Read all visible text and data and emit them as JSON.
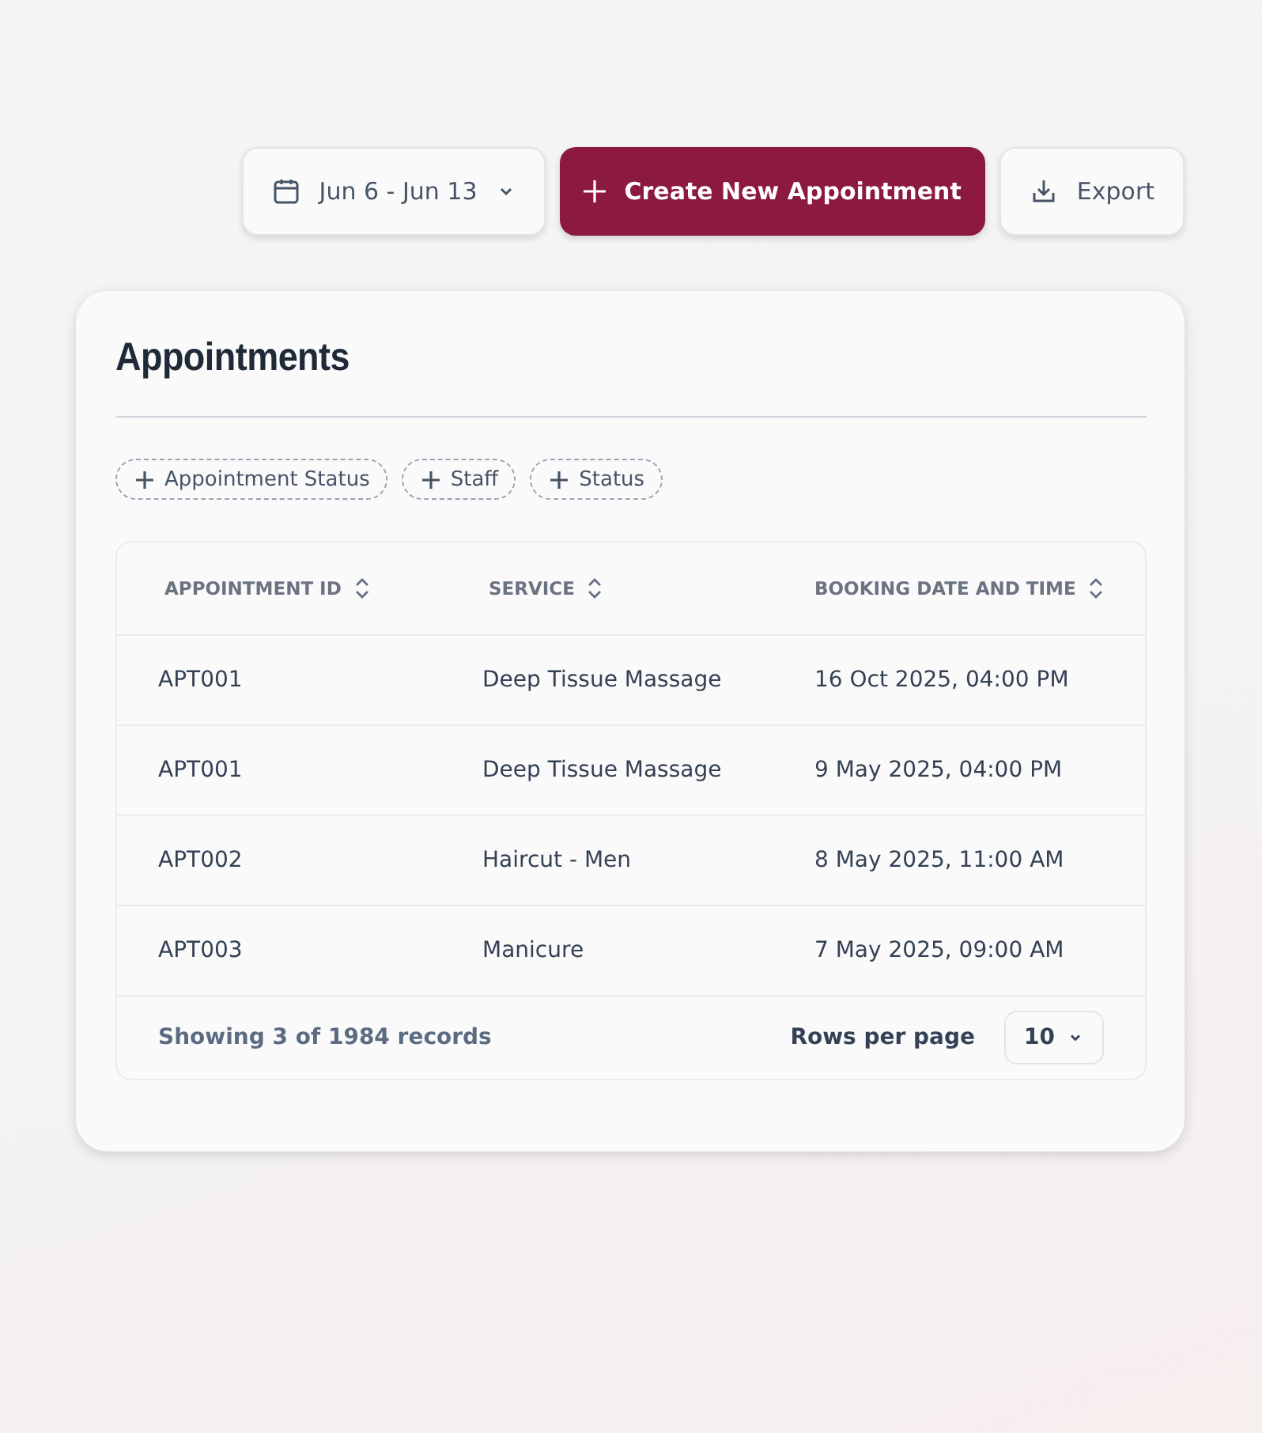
{
  "toolbar": {
    "date_range": "Jun 6 - Jun 13",
    "create_button": "Create New Appointment",
    "export_button": "Export"
  },
  "card": {
    "title": "Appointments",
    "filters": [
      "Appointment Status",
      "Staff",
      "Status"
    ],
    "table": {
      "columns": [
        "APPOINTMENT ID",
        "SERVICE",
        "BOOKING DATE AND TIME"
      ],
      "rows": [
        {
          "id": "APT001",
          "service": "Deep Tissue Massage",
          "booking": "16 Oct 2025, 04:00 PM"
        },
        {
          "id": "APT001",
          "service": "Deep Tissue Massage",
          "booking": "9 May 2025, 04:00 PM"
        },
        {
          "id": "APT002",
          "service": "Haircut - Men",
          "booking": "8 May 2025, 11:00 AM"
        },
        {
          "id": "APT003",
          "service": "Manicure",
          "booking": "7 May 2025, 09:00 AM"
        }
      ]
    },
    "footer": {
      "summary": "Showing 3 of 1984 records",
      "rows_per_page_label": "Rows per page",
      "rows_per_page": "10"
    }
  }
}
